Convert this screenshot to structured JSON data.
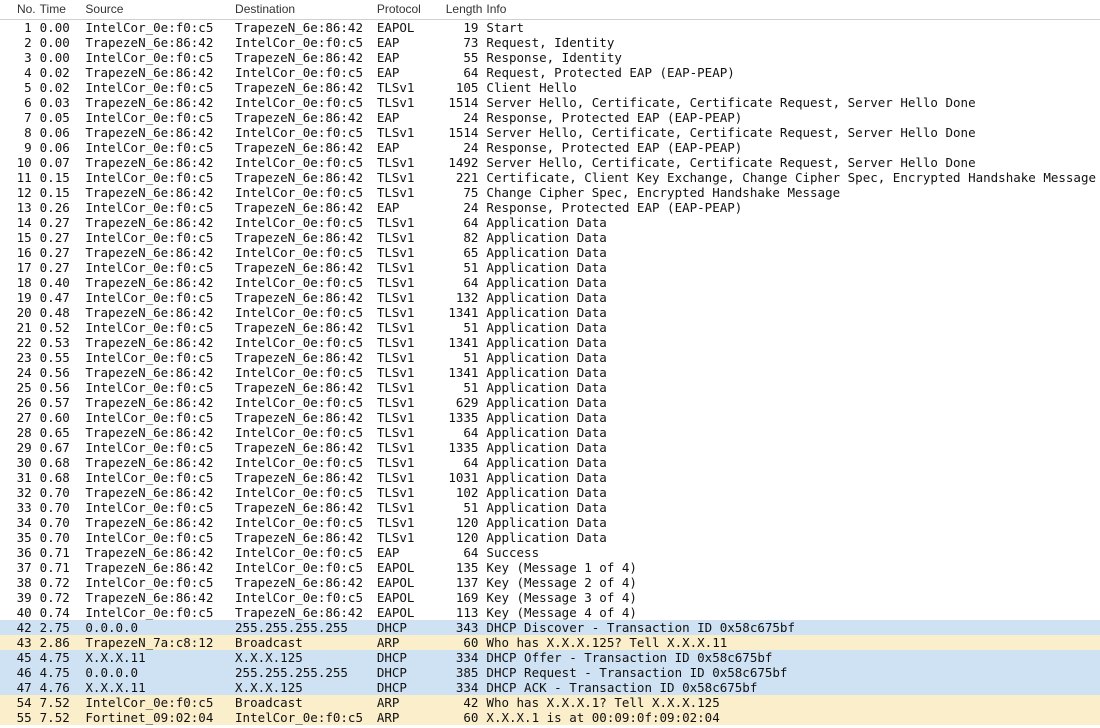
{
  "columns": {
    "no": "No.",
    "time": "Time",
    "source": "Source",
    "destination": "Destination",
    "protocol": "Protocol",
    "length": "Length",
    "info": "Info"
  },
  "rows": [
    {
      "no": 1,
      "time": "0.00",
      "src": "IntelCor_0e:f0:c5",
      "dst": "TrapezeN_6e:86:42",
      "proto": "EAPOL",
      "len": 19,
      "info": "Start",
      "color": "none"
    },
    {
      "no": 2,
      "time": "0.00",
      "src": "TrapezeN_6e:86:42",
      "dst": "IntelCor_0e:f0:c5",
      "proto": "EAP",
      "len": 73,
      "info": "Request, Identity",
      "color": "none"
    },
    {
      "no": 3,
      "time": "0.00",
      "src": "IntelCor_0e:f0:c5",
      "dst": "TrapezeN_6e:86:42",
      "proto": "EAP",
      "len": 55,
      "info": "Response, Identity",
      "color": "none"
    },
    {
      "no": 4,
      "time": "0.02",
      "src": "TrapezeN_6e:86:42",
      "dst": "IntelCor_0e:f0:c5",
      "proto": "EAP",
      "len": 64,
      "info": "Request, Protected EAP (EAP-PEAP)",
      "color": "none"
    },
    {
      "no": 5,
      "time": "0.02",
      "src": "IntelCor_0e:f0:c5",
      "dst": "TrapezeN_6e:86:42",
      "proto": "TLSv1",
      "len": 105,
      "info": "Client Hello",
      "color": "none"
    },
    {
      "no": 6,
      "time": "0.03",
      "src": "TrapezeN_6e:86:42",
      "dst": "IntelCor_0e:f0:c5",
      "proto": "TLSv1",
      "len": 1514,
      "info": "Server Hello, Certificate, Certificate Request, Server Hello Done",
      "color": "none"
    },
    {
      "no": 7,
      "time": "0.05",
      "src": "IntelCor_0e:f0:c5",
      "dst": "TrapezeN_6e:86:42",
      "proto": "EAP",
      "len": 24,
      "info": "Response, Protected EAP (EAP-PEAP)",
      "color": "none"
    },
    {
      "no": 8,
      "time": "0.06",
      "src": "TrapezeN_6e:86:42",
      "dst": "IntelCor_0e:f0:c5",
      "proto": "TLSv1",
      "len": 1514,
      "info": "Server Hello, Certificate, Certificate Request, Server Hello Done",
      "color": "none"
    },
    {
      "no": 9,
      "time": "0.06",
      "src": "IntelCor_0e:f0:c5",
      "dst": "TrapezeN_6e:86:42",
      "proto": "EAP",
      "len": 24,
      "info": "Response, Protected EAP (EAP-PEAP)",
      "color": "none"
    },
    {
      "no": 10,
      "time": "0.07",
      "src": "TrapezeN_6e:86:42",
      "dst": "IntelCor_0e:f0:c5",
      "proto": "TLSv1",
      "len": 1492,
      "info": "Server Hello, Certificate, Certificate Request, Server Hello Done",
      "color": "none"
    },
    {
      "no": 11,
      "time": "0.15",
      "src": "IntelCor_0e:f0:c5",
      "dst": "TrapezeN_6e:86:42",
      "proto": "TLSv1",
      "len": 221,
      "info": "Certificate, Client Key Exchange, Change Cipher Spec, Encrypted Handshake Message",
      "color": "none"
    },
    {
      "no": 12,
      "time": "0.15",
      "src": "TrapezeN_6e:86:42",
      "dst": "IntelCor_0e:f0:c5",
      "proto": "TLSv1",
      "len": 75,
      "info": "Change Cipher Spec, Encrypted Handshake Message",
      "color": "none"
    },
    {
      "no": 13,
      "time": "0.26",
      "src": "IntelCor_0e:f0:c5",
      "dst": "TrapezeN_6e:86:42",
      "proto": "EAP",
      "len": 24,
      "info": "Response, Protected EAP (EAP-PEAP)",
      "color": "none"
    },
    {
      "no": 14,
      "time": "0.27",
      "src": "TrapezeN_6e:86:42",
      "dst": "IntelCor_0e:f0:c5",
      "proto": "TLSv1",
      "len": 64,
      "info": "Application Data",
      "color": "none"
    },
    {
      "no": 15,
      "time": "0.27",
      "src": "IntelCor_0e:f0:c5",
      "dst": "TrapezeN_6e:86:42",
      "proto": "TLSv1",
      "len": 82,
      "info": "Application Data",
      "color": "none"
    },
    {
      "no": 16,
      "time": "0.27",
      "src": "TrapezeN_6e:86:42",
      "dst": "IntelCor_0e:f0:c5",
      "proto": "TLSv1",
      "len": 65,
      "info": "Application Data",
      "color": "none"
    },
    {
      "no": 17,
      "time": "0.27",
      "src": "IntelCor_0e:f0:c5",
      "dst": "TrapezeN_6e:86:42",
      "proto": "TLSv1",
      "len": 51,
      "info": "Application Data",
      "color": "none"
    },
    {
      "no": 18,
      "time": "0.40",
      "src": "TrapezeN_6e:86:42",
      "dst": "IntelCor_0e:f0:c5",
      "proto": "TLSv1",
      "len": 64,
      "info": "Application Data",
      "color": "none"
    },
    {
      "no": 19,
      "time": "0.47",
      "src": "IntelCor_0e:f0:c5",
      "dst": "TrapezeN_6e:86:42",
      "proto": "TLSv1",
      "len": 132,
      "info": "Application Data",
      "color": "none"
    },
    {
      "no": 20,
      "time": "0.48",
      "src": "TrapezeN_6e:86:42",
      "dst": "IntelCor_0e:f0:c5",
      "proto": "TLSv1",
      "len": 1341,
      "info": "Application Data",
      "color": "none"
    },
    {
      "no": 21,
      "time": "0.52",
      "src": "IntelCor_0e:f0:c5",
      "dst": "TrapezeN_6e:86:42",
      "proto": "TLSv1",
      "len": 51,
      "info": "Application Data",
      "color": "none"
    },
    {
      "no": 22,
      "time": "0.53",
      "src": "TrapezeN_6e:86:42",
      "dst": "IntelCor_0e:f0:c5",
      "proto": "TLSv1",
      "len": 1341,
      "info": "Application Data",
      "color": "none"
    },
    {
      "no": 23,
      "time": "0.55",
      "src": "IntelCor_0e:f0:c5",
      "dst": "TrapezeN_6e:86:42",
      "proto": "TLSv1",
      "len": 51,
      "info": "Application Data",
      "color": "none"
    },
    {
      "no": 24,
      "time": "0.56",
      "src": "TrapezeN_6e:86:42",
      "dst": "IntelCor_0e:f0:c5",
      "proto": "TLSv1",
      "len": 1341,
      "info": "Application Data",
      "color": "none"
    },
    {
      "no": 25,
      "time": "0.56",
      "src": "IntelCor_0e:f0:c5",
      "dst": "TrapezeN_6e:86:42",
      "proto": "TLSv1",
      "len": 51,
      "info": "Application Data",
      "color": "none"
    },
    {
      "no": 26,
      "time": "0.57",
      "src": "TrapezeN_6e:86:42",
      "dst": "IntelCor_0e:f0:c5",
      "proto": "TLSv1",
      "len": 629,
      "info": "Application Data",
      "color": "none"
    },
    {
      "no": 27,
      "time": "0.60",
      "src": "IntelCor_0e:f0:c5",
      "dst": "TrapezeN_6e:86:42",
      "proto": "TLSv1",
      "len": 1335,
      "info": "Application Data",
      "color": "none"
    },
    {
      "no": 28,
      "time": "0.65",
      "src": "TrapezeN_6e:86:42",
      "dst": "IntelCor_0e:f0:c5",
      "proto": "TLSv1",
      "len": 64,
      "info": "Application Data",
      "color": "none"
    },
    {
      "no": 29,
      "time": "0.67",
      "src": "IntelCor_0e:f0:c5",
      "dst": "TrapezeN_6e:86:42",
      "proto": "TLSv1",
      "len": 1335,
      "info": "Application Data",
      "color": "none"
    },
    {
      "no": 30,
      "time": "0.68",
      "src": "TrapezeN_6e:86:42",
      "dst": "IntelCor_0e:f0:c5",
      "proto": "TLSv1",
      "len": 64,
      "info": "Application Data",
      "color": "none"
    },
    {
      "no": 31,
      "time": "0.68",
      "src": "IntelCor_0e:f0:c5",
      "dst": "TrapezeN_6e:86:42",
      "proto": "TLSv1",
      "len": 1031,
      "info": "Application Data",
      "color": "none"
    },
    {
      "no": 32,
      "time": "0.70",
      "src": "TrapezeN_6e:86:42",
      "dst": "IntelCor_0e:f0:c5",
      "proto": "TLSv1",
      "len": 102,
      "info": "Application Data",
      "color": "none"
    },
    {
      "no": 33,
      "time": "0.70",
      "src": "IntelCor_0e:f0:c5",
      "dst": "TrapezeN_6e:86:42",
      "proto": "TLSv1",
      "len": 51,
      "info": "Application Data",
      "color": "none"
    },
    {
      "no": 34,
      "time": "0.70",
      "src": "TrapezeN_6e:86:42",
      "dst": "IntelCor_0e:f0:c5",
      "proto": "TLSv1",
      "len": 120,
      "info": "Application Data",
      "color": "none"
    },
    {
      "no": 35,
      "time": "0.70",
      "src": "IntelCor_0e:f0:c5",
      "dst": "TrapezeN_6e:86:42",
      "proto": "TLSv1",
      "len": 120,
      "info": "Application Data",
      "color": "none"
    },
    {
      "no": 36,
      "time": "0.71",
      "src": "TrapezeN_6e:86:42",
      "dst": "IntelCor_0e:f0:c5",
      "proto": "EAP",
      "len": 64,
      "info": "Success",
      "color": "none"
    },
    {
      "no": 37,
      "time": "0.71",
      "src": "TrapezeN_6e:86:42",
      "dst": "IntelCor_0e:f0:c5",
      "proto": "EAPOL",
      "len": 135,
      "info": "Key (Message 1 of 4)",
      "color": "none"
    },
    {
      "no": 38,
      "time": "0.72",
      "src": "IntelCor_0e:f0:c5",
      "dst": "TrapezeN_6e:86:42",
      "proto": "EAPOL",
      "len": 137,
      "info": "Key (Message 2 of 4)",
      "color": "none"
    },
    {
      "no": 39,
      "time": "0.72",
      "src": "TrapezeN_6e:86:42",
      "dst": "IntelCor_0e:f0:c5",
      "proto": "EAPOL",
      "len": 169,
      "info": "Key (Message 3 of 4)",
      "color": "none"
    },
    {
      "no": 40,
      "time": "0.74",
      "src": "IntelCor_0e:f0:c5",
      "dst": "TrapezeN_6e:86:42",
      "proto": "EAPOL",
      "len": 113,
      "info": "Key (Message 4 of 4)",
      "color": "none"
    },
    {
      "no": 42,
      "time": "2.75",
      "src": "0.0.0.0",
      "dst": "255.255.255.255",
      "proto": "DHCP",
      "len": 343,
      "info": "DHCP Discover - Transaction ID 0x58c675bf",
      "color": "dhcp"
    },
    {
      "no": 43,
      "time": "2.86",
      "src": "TrapezeN_7a:c8:12",
      "dst": "Broadcast",
      "proto": "ARP",
      "len": 60,
      "info": "Who has   X.X.X.125?  Tell   X.X.X.11",
      "color": "arp"
    },
    {
      "no": 45,
      "time": "4.75",
      "src": "  X.X.X.11",
      "dst": "  X.X.X.125",
      "proto": "DHCP",
      "len": 334,
      "info": "DHCP Offer    - Transaction ID 0x58c675bf",
      "color": "dhcp"
    },
    {
      "no": 46,
      "time": "4.75",
      "src": "0.0.0.0",
      "dst": "255.255.255.255",
      "proto": "DHCP",
      "len": 385,
      "info": "DHCP Request  - Transaction ID 0x58c675bf",
      "color": "dhcp"
    },
    {
      "no": 47,
      "time": "4.76",
      "src": "  X.X.X.11",
      "dst": "  X.X.X.125",
      "proto": "DHCP",
      "len": 334,
      "info": "DHCP ACK      - Transaction ID 0x58c675bf",
      "color": "dhcp"
    },
    {
      "no": 54,
      "time": "7.52",
      "src": "IntelCor_0e:f0:c5",
      "dst": "Broadcast",
      "proto": "ARP",
      "len": 42,
      "info": "Who has   X.X.X.1?  Tell   X.X.X.125",
      "color": "arp"
    },
    {
      "no": 55,
      "time": "7.52",
      "src": "Fortinet_09:02:04",
      "dst": "IntelCor_0e:f0:c5",
      "proto": "ARP",
      "len": 60,
      "info": "  X.X.X.1 is at 00:09:0f:09:02:04",
      "color": "arp"
    }
  ]
}
